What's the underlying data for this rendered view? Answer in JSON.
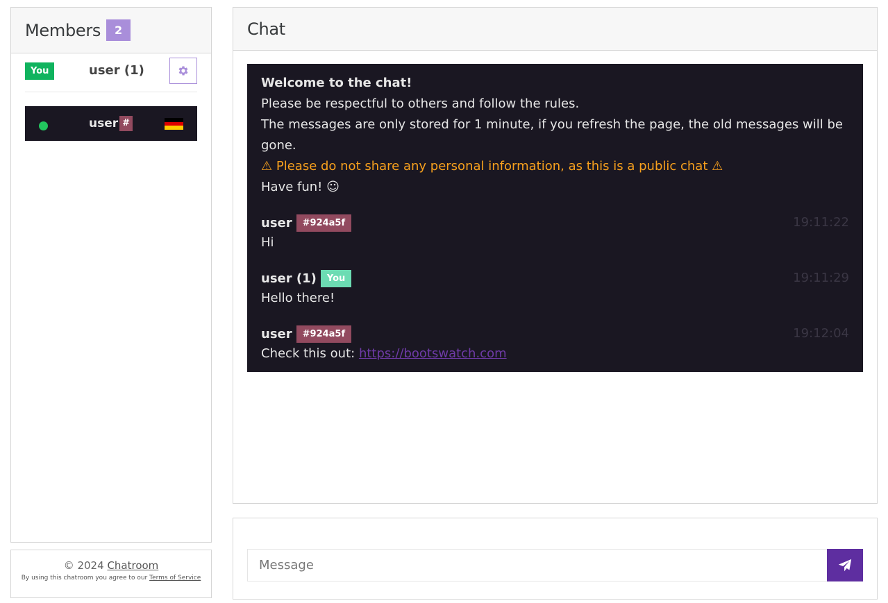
{
  "members": {
    "title": "Members",
    "count": "2",
    "self": {
      "badge": "You",
      "name": "user (1)"
    },
    "others": [
      {
        "name": "user",
        "hash": "#"
      }
    ]
  },
  "footer": {
    "copyright": "© 2024",
    "brand": "Chatroom",
    "agree_text": "By using this chatroom you agree to our",
    "tos": "Terms of Service"
  },
  "chat": {
    "title": "Chat",
    "welcome": {
      "title": "Welcome to the chat!",
      "line1": "Please be respectful to others and follow the rules.",
      "line2": "The messages are only stored for 1 minute, if you refresh the page, the old messages will be gone.",
      "warning": "⚠ Please do not share any personal information, as this is a public chat ⚠",
      "line3": "Have fun! ☺"
    },
    "messages": [
      {
        "user": "user",
        "tag": "#924a5f",
        "time": "19:11:22",
        "text": "Hi"
      },
      {
        "user": "user (1)",
        "tag": "You",
        "time": "19:11:29",
        "text": "Hello there!"
      },
      {
        "user": "user",
        "tag": "#924a5f",
        "time": "19:12:04",
        "text_prefix": "Check this out:",
        "link": "https://bootswatch.com"
      }
    ]
  },
  "composer": {
    "placeholder": "Message"
  },
  "colors": {
    "accent": "#a98eda",
    "send": "#5e2ea0",
    "chat_bg": "#1a1722",
    "hash_badge": "#924a5f",
    "you_badge_green": "#10b35e",
    "you_badge_teal": "#6cdcb3",
    "warning": "#f7a01d"
  },
  "icons": {
    "settings": "gear-icon",
    "send": "paper-plane-icon",
    "flag": "germany-flag-icon",
    "online": "online-dot-icon"
  }
}
